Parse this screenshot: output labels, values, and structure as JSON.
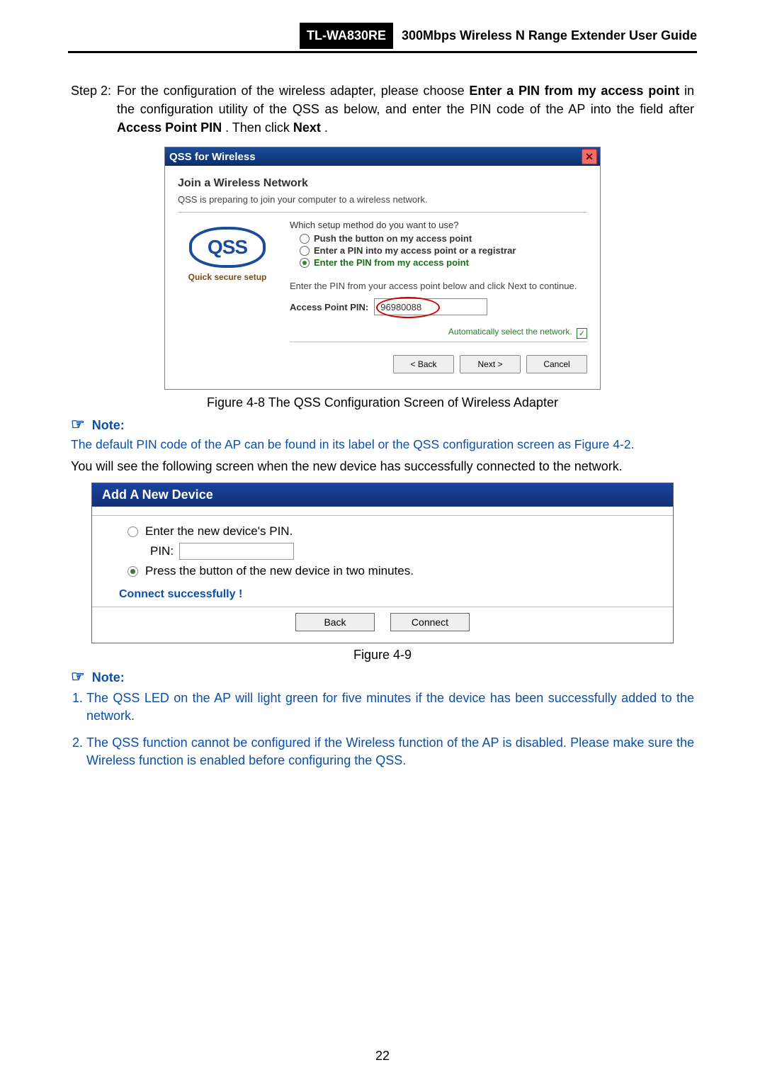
{
  "header": {
    "model": "TL-WA830RE",
    "title": "300Mbps Wireless N Range Extender User Guide"
  },
  "step": {
    "label": "Step 2:",
    "pre": "For the configuration of the wireless adapter, please choose ",
    "bold1": "Enter a PIN from my access point",
    "mid1": " in the configuration utility of the QSS as below, and enter the PIN code of the AP into the field after ",
    "bold2": "Access Point PIN",
    "mid2": ". Then click ",
    "bold3": "Next",
    "end": "."
  },
  "dlg1": {
    "title": "QSS for Wireless",
    "h": "Join a Wireless Network",
    "sub": "QSS is preparing to join your computer to a wireless network.",
    "logo": "QSS",
    "logo_cap": "Quick secure setup",
    "question": "Which setup method do you want to use?",
    "opt1": "Push the button on my access point",
    "opt2": "Enter a PIN into my access point or a registrar",
    "opt3": "Enter the PIN from my access point",
    "instr": "Enter the PIN from your access point below and click Next to continue.",
    "pin_label": "Access Point PIN:",
    "pin_value": "96980088",
    "auto": "Automatically select the network.",
    "back": "< Back",
    "next": "Next >",
    "cancel": "Cancel"
  },
  "fig1": "Figure 4-8 The QSS Configuration Screen of Wireless Adapter",
  "note1_hdr": "Note:",
  "note1_body": "The default PIN code of the AP can be found in its label or the QSS configuration screen as Figure 4-2.",
  "plain1": "You will see the following screen when the new device has successfully connected to the network.",
  "dlg2": {
    "title": "Add A New Device",
    "opt1": "Enter the new device's PIN.",
    "pin_label": "PIN:",
    "opt2": "Press the button of the new device in two minutes.",
    "success": "Connect successfully !",
    "back": "Back",
    "connect": "Connect"
  },
  "fig2": "Figure 4-9",
  "note2_hdr": "Note:",
  "notes_list": {
    "i1": "The QSS LED on the AP will light green for five minutes if the device has been successfully added to the network.",
    "i2": "The QSS function cannot be configured if the Wireless function of the AP is disabled. Please make sure the Wireless function is enabled before configuring the QSS."
  },
  "page_num": "22"
}
